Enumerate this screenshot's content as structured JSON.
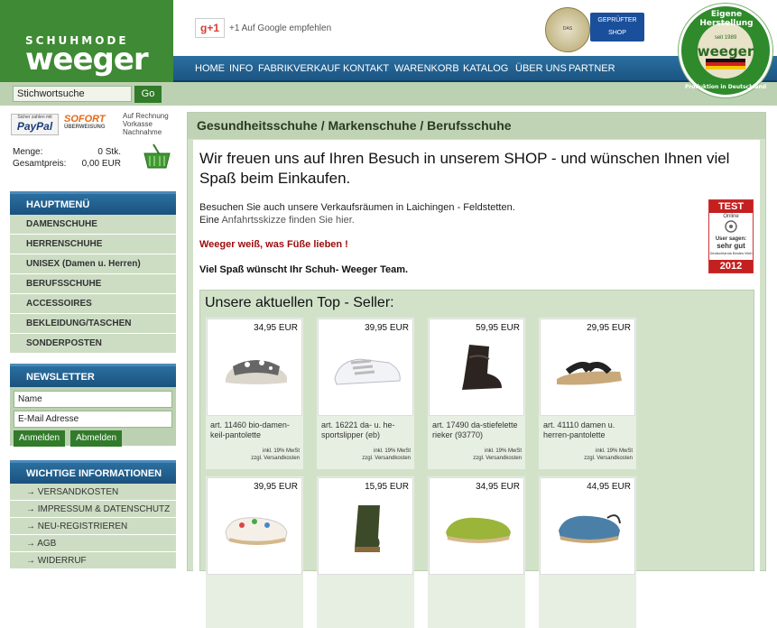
{
  "logo": {
    "line1": "SCHUHMODE",
    "line2": "weeger"
  },
  "google": {
    "icon": "g+1",
    "text": "+1   Auf Google empfehlen"
  },
  "badges": {
    "seal_text": "DAS INTERNETSIEGEL",
    "shop_line1": "GEPRÜFTER SHOP",
    "shop_line2": "Sicher einkaufen"
  },
  "round_badge": {
    "top": "Eigene Herstellung",
    "center": "weeger",
    "since": "seit 1989",
    "bottom": "Produktion in Deutschland"
  },
  "nav": {
    "items": [
      "HOME",
      "INFO",
      "FABRIKVERKAUF",
      "KONTAKT",
      "WARENKORB",
      "KATALOG",
      "ÜBER UNS",
      "PARTNER"
    ]
  },
  "search": {
    "value": "Stichwortsuche",
    "button": "Go"
  },
  "payment": {
    "paypal_small": "Sicher zahlen mit",
    "paypal": "PayPal",
    "sofort": "SOFORT",
    "sofort_small": "ÜBERWEISUNG",
    "rest": [
      "Auf Rechnung",
      "Vorkasse",
      "Nachnahme"
    ]
  },
  "cart": {
    "qty_label": "Menge:",
    "qty_value": "0 Stk.",
    "total_label": "Gesamtpreis:",
    "total_value": "0,00 EUR"
  },
  "mainmenu": {
    "title": "HAUPTMENÜ",
    "items": [
      "DAMENSCHUHE",
      "HERRENSCHUHE",
      "UNISEX (Damen u. Herren)",
      "BERUFSSCHUHE",
      "ACCESSOIRES",
      "BEKLEIDUNG/TASCHEN",
      "SONDERPOSTEN"
    ]
  },
  "newsletter": {
    "title": "NEWSLETTER",
    "name_value": "Name",
    "email_value": "E-Mail Adresse",
    "subscribe": "Anmelden",
    "unsubscribe": "Abmelden"
  },
  "info": {
    "title": "WICHTIGE INFORMATIONEN",
    "items": [
      "→ VERSANDKOSTEN",
      "→ IMPRESSUM & DATENSCHUTZ",
      "→ NEU-REGISTRIEREN",
      "→ AGB",
      "→ WIDERRUF"
    ]
  },
  "main": {
    "breadcrumb": "Gesundheitsschuhe / Markenschuhe / Berufsschuhe",
    "headline": "Wir freuen uns auf Ihren Besuch in unserem SHOP - und wünschen Ihnen viel Spaß beim Einkaufen.",
    "p1": "Besuchen Sie auch unsere Verkaufsräumen in Laichingen - Feldstetten.",
    "p2_pre": "Eine ",
    "p2_link": "Anfahrtsskizze finden Sie hier.",
    "red": "Weeger weiß, was Füße lieben !",
    "team": "Viel Spaß wünscht Ihr Schuh- Weeger Team.",
    "test": {
      "top": "TEST",
      "online": "Online",
      "user": "User sagen:",
      "grade": "sehr gut",
      "source": "Deutschlands Bestes Web",
      "year": "2012"
    },
    "topseller_title": "Unsere aktuellen Top - Seller:",
    "vat_line1": "inkl. 19% MwSt",
    "vat_line2": "zzgl. Versandkosten",
    "products": [
      {
        "price": "34,95 EUR",
        "name": "art. 11460 bio-damen-keil-pantolette"
      },
      {
        "price": "39,95 EUR",
        "name": "art. 16221 da- u. he-sportslipper (eb)"
      },
      {
        "price": "59,95 EUR",
        "name": "art. 17490 da-stiefelette rieker (93770)"
      },
      {
        "price": "29,95 EUR",
        "name": "art. 41110 damen u. herren-pantolette"
      },
      {
        "price": "39,95 EUR",
        "name": ""
      },
      {
        "price": "15,95 EUR",
        "name": ""
      },
      {
        "price": "34,95 EUR",
        "name": ""
      },
      {
        "price": "44,95 EUR",
        "name": ""
      }
    ]
  },
  "colors": {
    "green": "#3f8a34",
    "nav_blue": "#1c5583",
    "menu_bg": "#cdddc4",
    "red_text": "#9b0b0b"
  }
}
